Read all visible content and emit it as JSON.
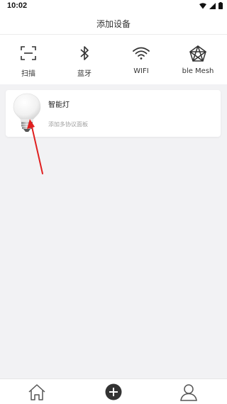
{
  "status_bar": {
    "time": "10:02"
  },
  "header": {
    "title": "添加设备"
  },
  "methods": [
    {
      "label": "扫描",
      "icon": "scan-icon"
    },
    {
      "label": "蓝牙",
      "icon": "bluetooth-icon"
    },
    {
      "label": "WIFI",
      "icon": "wifi-icon"
    },
    {
      "label": "ble Mesh",
      "icon": "mesh-icon"
    }
  ],
  "device": {
    "name": "智能灯",
    "subtitle": "添加多协议面板",
    "icon": "light-bulb-icon"
  },
  "tabbar": {
    "items": [
      {
        "icon": "home-icon"
      },
      {
        "icon": "add-circle-icon"
      },
      {
        "icon": "user-icon"
      }
    ]
  },
  "colors": {
    "annotation_arrow": "#e02020",
    "background": "#f2f2f4",
    "add_button": "#333333"
  }
}
